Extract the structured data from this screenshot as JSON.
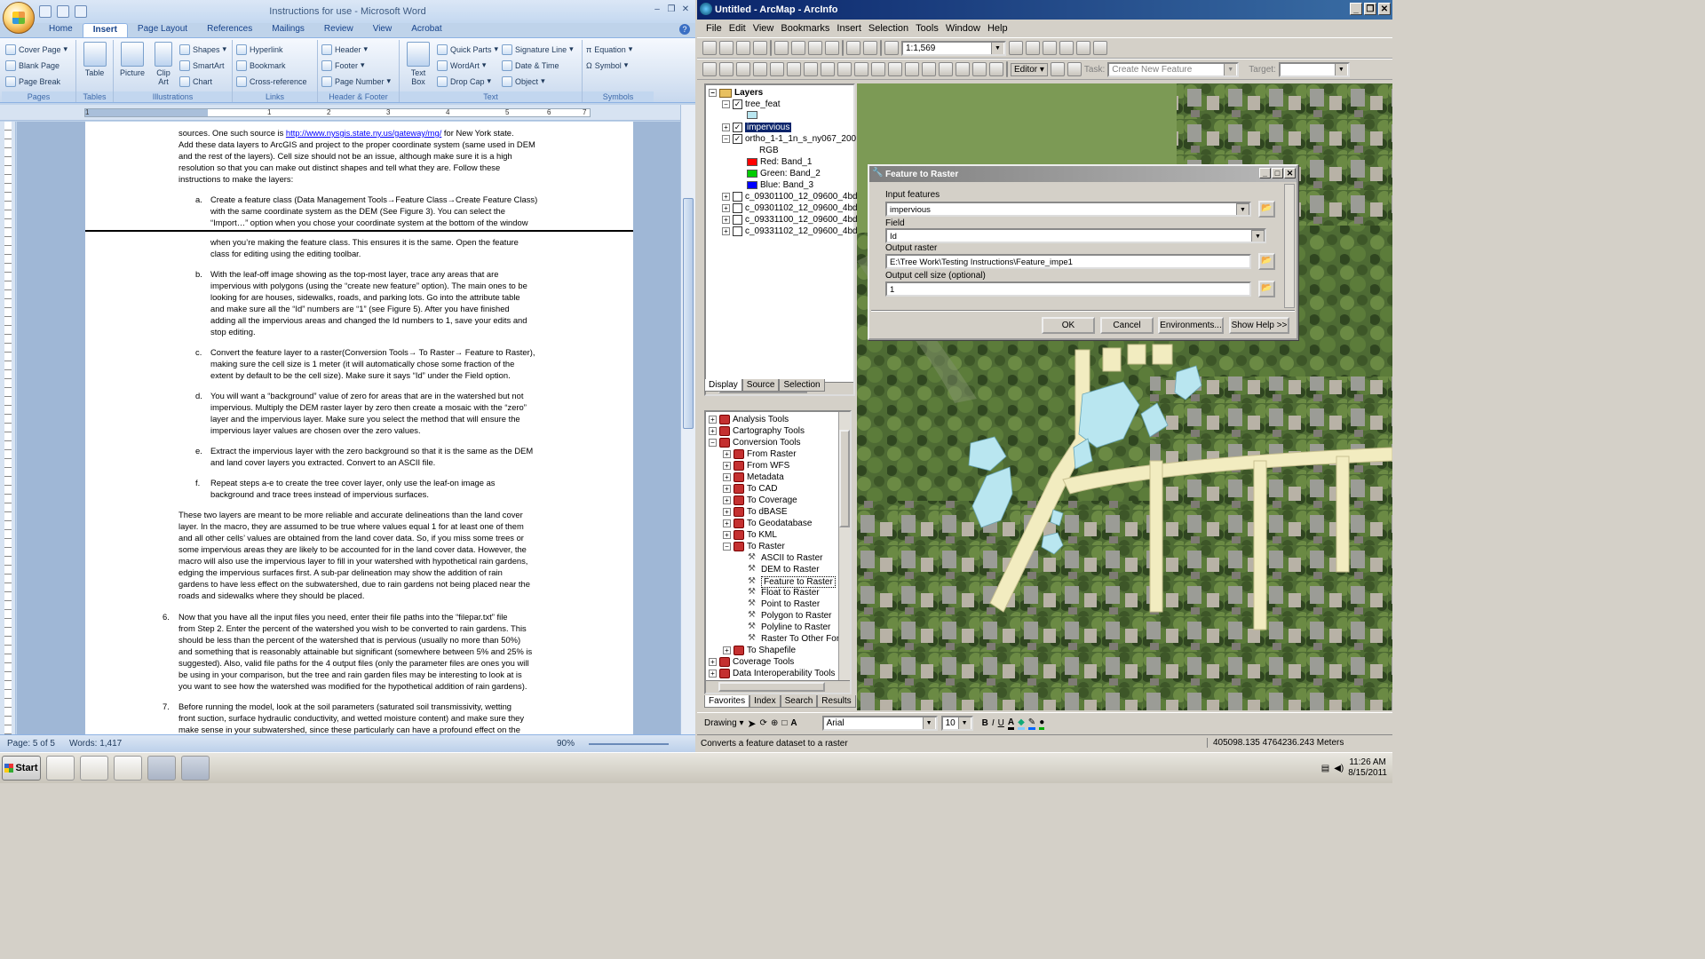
{
  "word": {
    "title": "Instructions for use - Microsoft Word",
    "tabs": [
      "Home",
      "Insert",
      "Page Layout",
      "References",
      "Mailings",
      "Review",
      "View",
      "Acrobat"
    ],
    "active_tab": "Insert",
    "ribbon": {
      "pages": {
        "name": "Pages",
        "items": [
          "Cover Page",
          "Blank Page",
          "Page Break"
        ]
      },
      "tables": {
        "name": "Tables",
        "items": [
          "Table"
        ]
      },
      "illustrations": {
        "name": "Illustrations",
        "picture": "Picture",
        "clip_art": "Clip Art",
        "items": [
          "Shapes",
          "SmartArt",
          "Chart"
        ]
      },
      "links": {
        "name": "Links",
        "items": [
          "Hyperlink",
          "Bookmark",
          "Cross-reference"
        ]
      },
      "header_footer": {
        "name": "Header & Footer",
        "items": [
          "Header",
          "Footer",
          "Page Number"
        ]
      },
      "text": {
        "name": "Text",
        "text_box": "Text Box",
        "items_a": [
          "Quick Parts",
          "WordArt",
          "Drop Cap"
        ],
        "items_b": [
          "Signature Line",
          "Date & Time",
          "Object"
        ]
      },
      "symbols": {
        "name": "Symbols",
        "items": [
          "Equation",
          "Symbol"
        ]
      }
    },
    "ruler_numbers": [
      "1",
      "1",
      "2",
      "3",
      "4",
      "5",
      "6",
      "7"
    ],
    "doc": {
      "p0a": "sources.  One such source is ",
      "p0link": "http://www.nysgis.state.ny.us/gateway/mg/",
      "p0b": "  for New York state.",
      "p0c": "Add these data layers to ArcGIS and project to the proper coordinate system (same used in DEM\nand the rest of the layers).  Cell size should not be an issue, although make sure it is a high\nresolution so that you can make out distinct shapes and tell what they are.  Follow these\ninstructions to make the layers:",
      "a_label": "a.",
      "a_text": "Create a feature class (Data Management Tools→Feature Class→Create Feature Class)\nwith the same coordinate system as the DEM (See Figure 3).  You can select the\n“Import…” option when you chose your coordinate system at the bottom of the window",
      "a_cont": "when you’re making the feature class.  This ensures it is the same.   Open the feature\nclass for editing using the editing toolbar.",
      "b_label": "b.",
      "b_text": "With the leaf-off image showing as the top-most layer, trace any areas that are\nimpervious with polygons (using the “create new feature” option).  The main ones to be\nlooking for are houses, sidewalks, roads, and parking lots.  Go into the attribute table\nand make sure all the “Id” numbers are “1” (see Figure 5).  After you have finished\nadding all the impervious areas and changed the Id numbers to 1, save your edits and\nstop editing.",
      "c_label": "c.",
      "c_text": "Convert the feature layer to a raster(Conversion Tools→ To Raster→ Feature to Raster),\nmaking sure the cell size is 1 meter (it will automatically  chose some fraction of the\nextent by default to be the cell size).  Make sure it says “Id” under the Field option.",
      "d_label": "d.",
      "d_text": "You will want a “background” value of zero for areas that are in the watershed but not\nimpervious.  Multiply the DEM raster layer by zero then create a mosaic with the “zero”\nlayer and the impervious layer.  Make sure you select the method that will ensure the\nimpervious layer values are chosen over the zero values.",
      "e_label": "e.",
      "e_text": "Extract the impervious layer with the zero background so that it is the same as the DEM\nand land cover layers you extracted.  Convert to an ASCII file.",
      "f_label": "f.",
      "f_text": "Repeat steps a-e to create the tree cover layer, only use the leaf-on image as\nbackground and trace trees instead of impervious surfaces.",
      "p_layers": "These two layers are meant to be more reliable and accurate delineations than the land cover\nlayer.  In the macro, they are assumed to be true where values equal 1 for at least one of them\nand all other cells’ values are obtained from the land cover data.  So, if you miss some trees or\nsome impervious areas they are likely to be accounted for in the land cover data.  However, the\nmacro will also use the impervious layer to fill in your watershed with hypothetical rain gardens,\nedging the impervious surfaces first.  A sub-par delineation may show the addition of rain\ngardens to have less effect on the subwatershed, due to rain gardens not being placed near the\nroads and sidewalks where they should be placed.",
      "n6_label": "6.",
      "n6_text": "Now that you have all the input files you need, enter their file paths into the “filepar.txt” file\nfrom Step 2.  Enter the percent of the watershed you wish to be converted to rain gardens.  This\nshould be less than the percent of the watershed that is pervious (usually no more than 50%)\nand something that is reasonably attainable  but significant (somewhere between 5% and 25% is\nsuggested).  Also, valid file paths for the 4 output files (only the parameter files are ones you will\nbe using in your comparison, but the tree and rain garden files may be interesting to look at is\nyou want to see how the watershed was modified for the hypothetical addition of rain gardens).",
      "n7_label": "7.",
      "n7_text": "Before running the model, look at the soil parameters (saturated soil transmissivity,  wetting\nfront suction, surface hydraulic conductivity, and wetted moisture content)  and make sure they\nmake sense in your subwatershed, since these particularly can have a profound effect on the"
    },
    "status": {
      "page": "Page: 5 of 5",
      "words": "Words: 1,417",
      "zoom": "90%"
    }
  },
  "arcmap": {
    "title": "Untitled - ArcMap - ArcInfo",
    "menu": [
      "File",
      "Edit",
      "View",
      "Bookmarks",
      "Insert",
      "Selection",
      "Tools",
      "Window",
      "Help"
    ],
    "scale": "1:1,569",
    "editor_label": "Editor ▾",
    "task_label": "Task:",
    "task_value": "Create New Feature",
    "target_label": "Target:",
    "toc": {
      "root": "Layers",
      "layers": [
        "tree_feat",
        "impervious",
        "ortho_1-1_1n_s_ny067_200"
      ],
      "rgb": "RGB",
      "bands": [
        {
          "label": "Red:   Band_1",
          "color": "#ff0000"
        },
        {
          "label": "Green: Band_2",
          "color": "#00cc00"
        },
        {
          "label": "Blue:  Band_3",
          "color": "#0000ff"
        }
      ],
      "rasters": [
        "c_09301100_12_09600_4bd",
        "c_09301102_12_09600_4bd",
        "c_09331100_12_09600_4bd",
        "c_09331102_12_09600_4bd"
      ],
      "tabs": [
        "Display",
        "Source",
        "Selection"
      ]
    },
    "toolbox": {
      "items": [
        "Analysis Tools",
        "Cartography Tools",
        "Conversion Tools"
      ],
      "conversion_children": [
        "From Raster",
        "From WFS",
        "Metadata",
        "To CAD",
        "To Coverage",
        "To dBASE",
        "To Geodatabase",
        "To KML",
        "To Raster"
      ],
      "raster_tools": [
        "ASCII to Raster",
        "DEM to Raster",
        "Feature to Raster",
        "Float to Raster",
        "Point to Raster",
        "Polygon to Raster",
        "Polyline to Raster",
        "Raster To Other Form"
      ],
      "after": [
        "To Shapefile"
      ],
      "more": [
        "Coverage Tools",
        "Data Interoperability Tools"
      ],
      "tabs": [
        "Favorites",
        "Index",
        "Search",
        "Results"
      ]
    },
    "dialog": {
      "title": "Feature to Raster",
      "input_label": "Input features",
      "input_value": "impervious",
      "field_label": "Field",
      "field_value": "Id",
      "output_label": "Output raster",
      "output_value": "E:\\Tree Work\\Testing Instructions\\Feature_impe1",
      "cell_label": "Output cell size (optional)",
      "cell_value": "1",
      "buttons": [
        "OK",
        "Cancel",
        "Environments...",
        "Show Help >>"
      ]
    },
    "drawing": {
      "label": "Drawing ▾",
      "font": "Arial",
      "size": "10",
      "bold": "B",
      "italic": "I",
      "underline": "U"
    },
    "status": {
      "message": "Converts a feature dataset to a raster",
      "coords": "405098.135  4764236.243 Meters"
    }
  },
  "taskbar": {
    "start": "Start",
    "time": "11:26 AM",
    "date": "8/15/2011"
  },
  "colors": {
    "impervious_fill": "#b9e6f0",
    "road_fill": "#f2ecc0",
    "selection": "#0a246a"
  }
}
